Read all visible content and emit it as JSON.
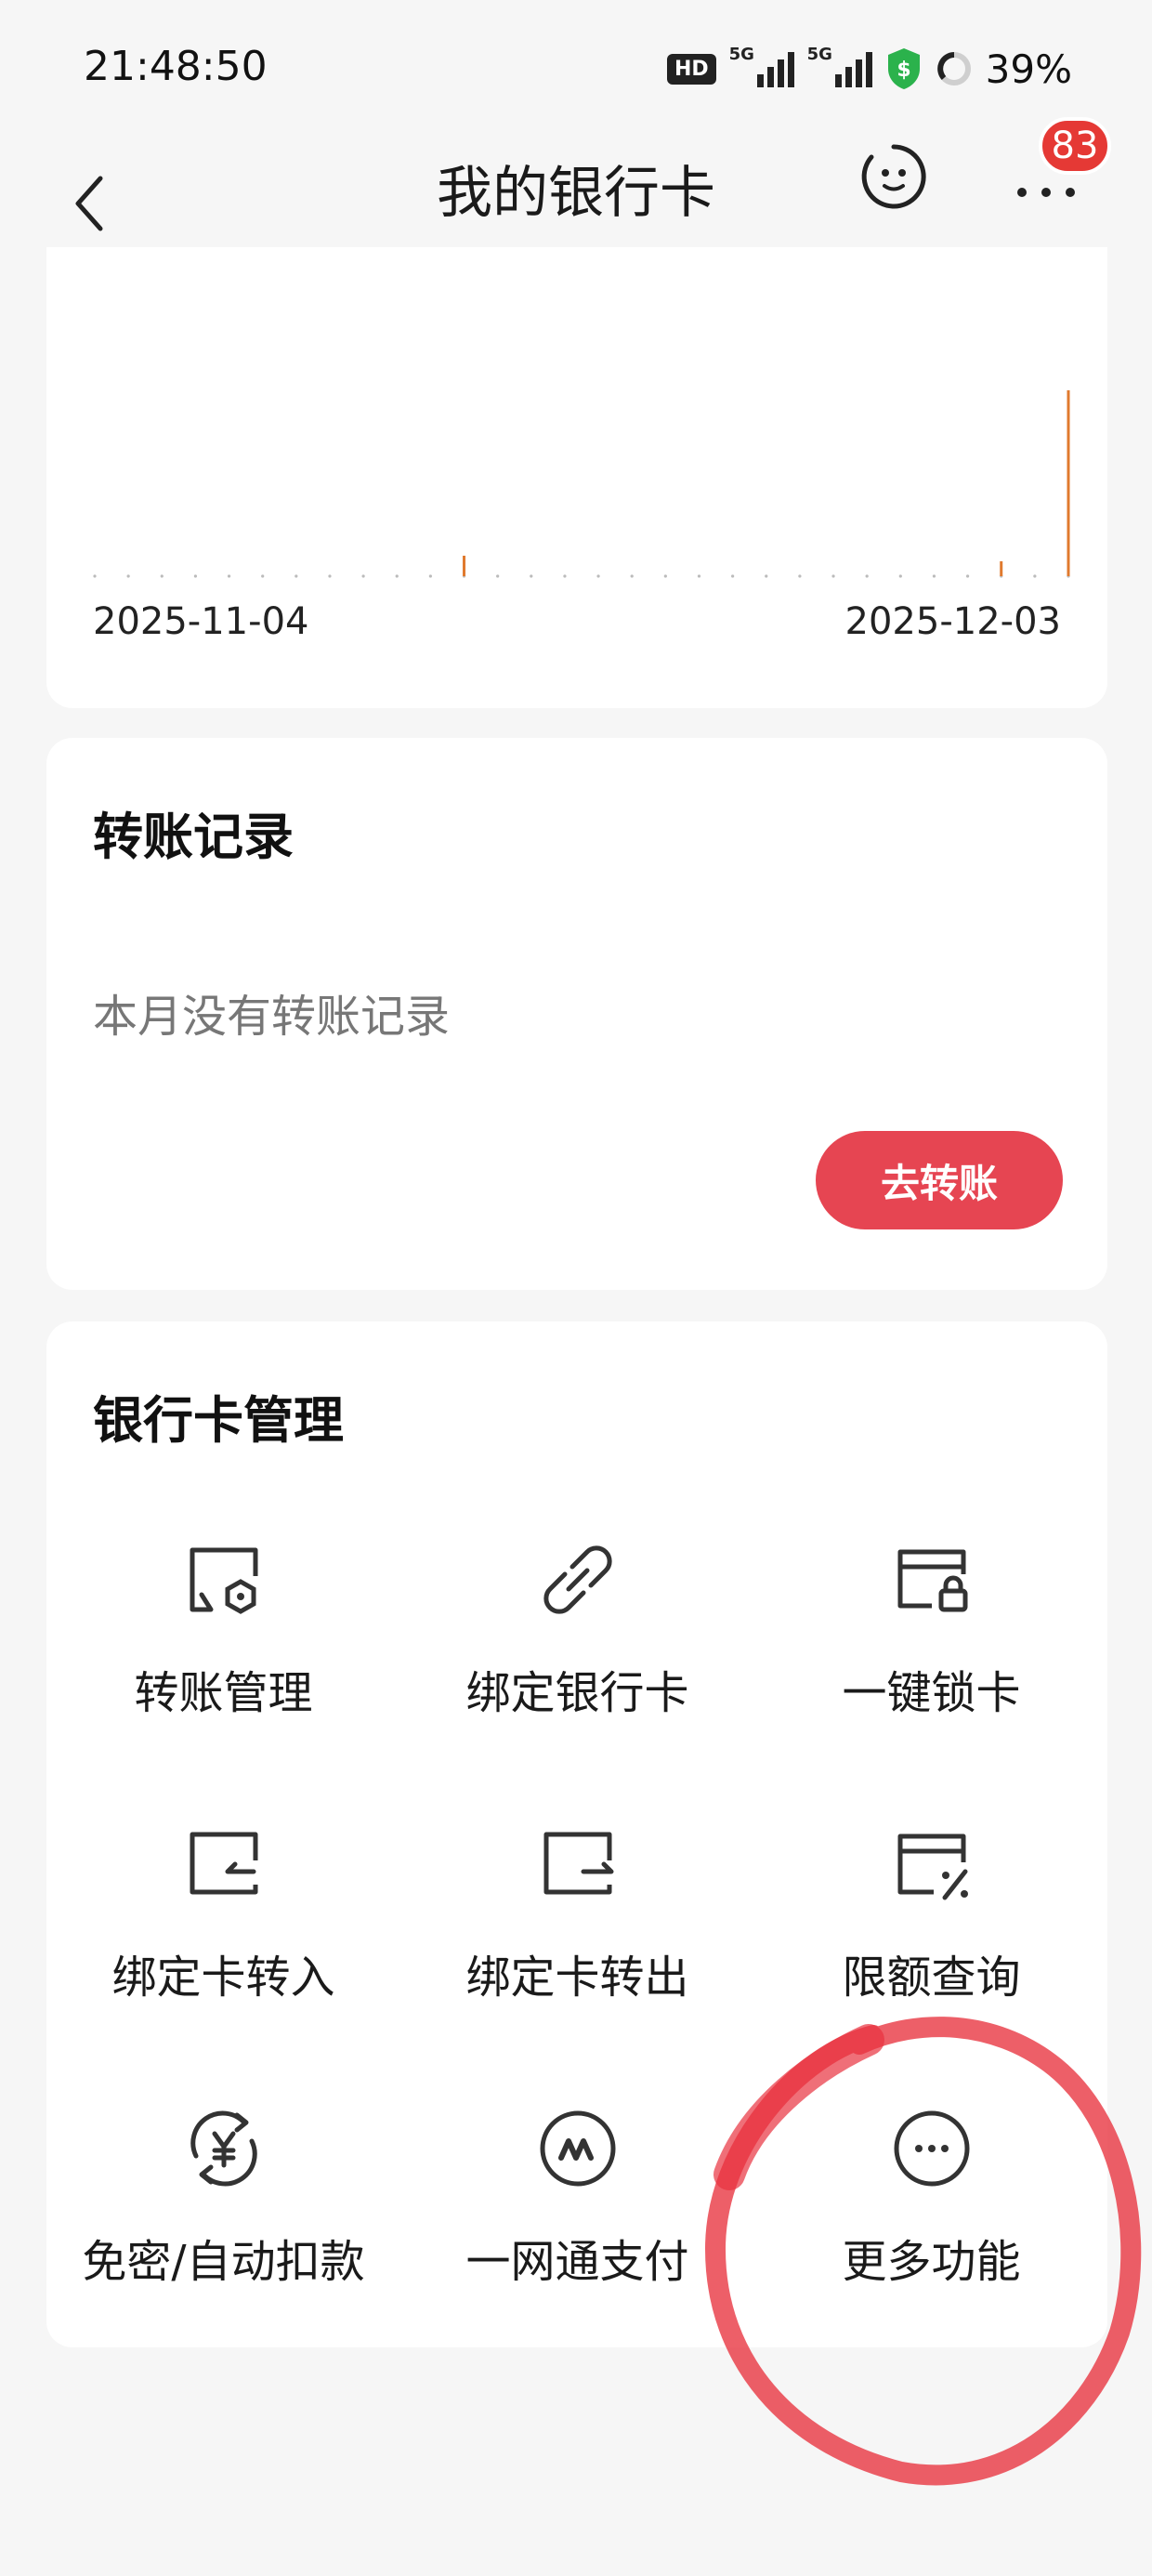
{
  "status_bar": {
    "time": "21:48:50",
    "hd_label": "HD",
    "network_1": "5G",
    "network_2": "5G",
    "battery": "39%"
  },
  "nav": {
    "title": "我的银行卡",
    "badge_count": "83"
  },
  "chart_card": {
    "start_date": "2025-11-04",
    "end_date": "2025-12-03",
    "bar_color": "#e07a2e"
  },
  "chart_data": {
    "type": "bar",
    "categories": [
      "2025-11-04",
      "2025-12-03"
    ],
    "x_start": "2025-11-04",
    "x_end": "2025-12-03",
    "day_count": 30,
    "bars": [
      {
        "day_index": 11,
        "value": 0.11
      },
      {
        "day_index": 27,
        "value": 0.08
      },
      {
        "day_index": 29,
        "value": 1.0
      }
    ],
    "title": "",
    "xlabel": "",
    "ylabel": ""
  },
  "transfer_card": {
    "title": "转账记录",
    "empty_text": "本月没有转账记录",
    "button_label": "去转账"
  },
  "manage_card": {
    "title": "银行卡管理",
    "items": [
      {
        "label": "转账管理",
        "icon": "card-settings-icon"
      },
      {
        "label": "绑定银行卡",
        "icon": "link-icon"
      },
      {
        "label": "一键锁卡",
        "icon": "card-lock-icon"
      },
      {
        "label": "绑定卡转入",
        "icon": "card-transfer-in-icon"
      },
      {
        "label": "绑定卡转出",
        "icon": "card-transfer-out-icon"
      },
      {
        "label": "限额查询",
        "icon": "card-percent-icon"
      },
      {
        "label": "免密/自动扣款",
        "icon": "yuan-refresh-icon"
      },
      {
        "label": "一网通支付",
        "icon": "netpay-icon"
      },
      {
        "label": "更多功能",
        "icon": "more-dots-icon"
      }
    ]
  },
  "colors": {
    "accent_red": "#e64552",
    "badge_red": "#e53935",
    "annotation_red": "#e8323e"
  }
}
